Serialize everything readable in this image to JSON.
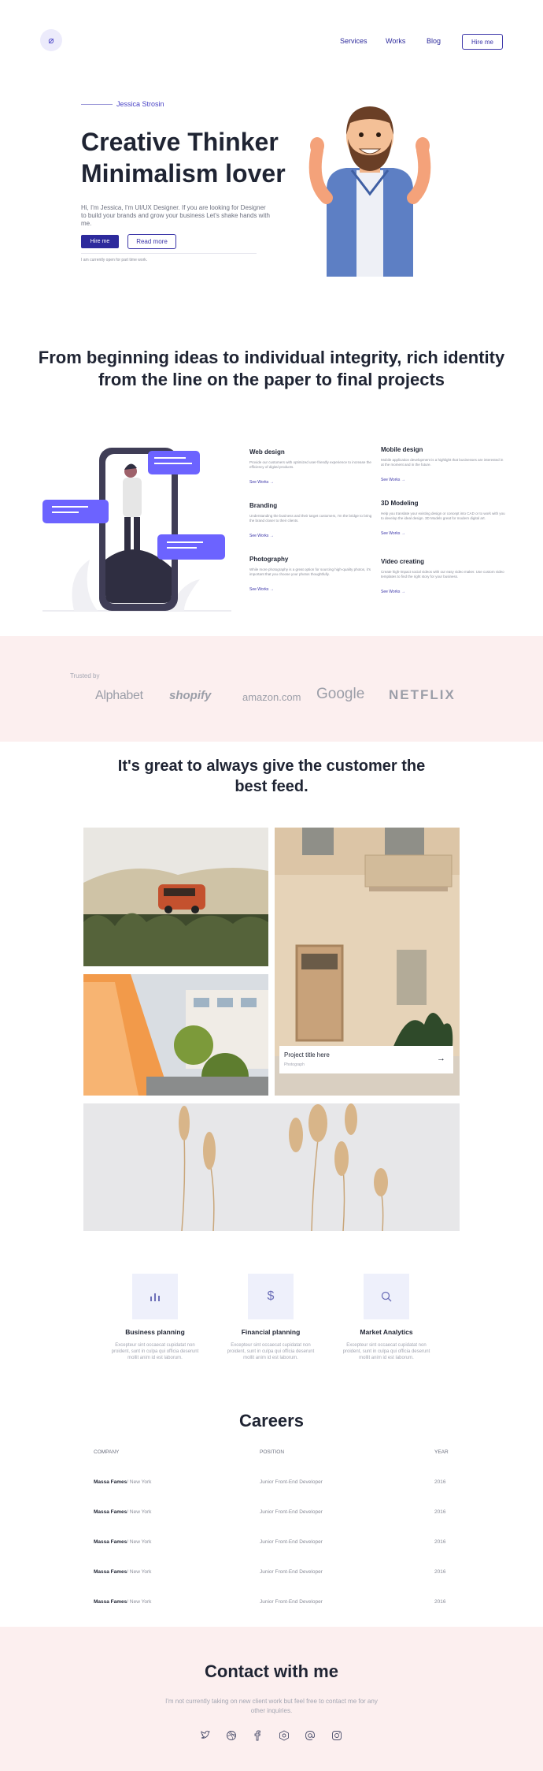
{
  "header": {
    "logo_glyph": "⌀",
    "nav": [
      "Services",
      "Works",
      "Blog"
    ],
    "hire_label": "Hire me"
  },
  "hero": {
    "eyebrow": "Jessica Strosin",
    "title_line1": "Creative Thinker",
    "title_line2": "Minimalism lover",
    "description": "Hi, I'm Jessica, I'm UI/UX Designer. If you are looking for Designer to build your brands and grow your business Let's shake hands with me.",
    "primary_button": "Hire me",
    "secondary_button": "Read more",
    "note": "I am currently open for part time work."
  },
  "tagline": "From beginning ideas to individual integrity, rich identity from the line on the paper to final projects",
  "services": [
    {
      "title": "Web design",
      "desc": "Provide our customers with optimized user-friendly experience to increase the efficiency of digital products.",
      "link": "See Works →"
    },
    {
      "title": "Mobile design",
      "desc": "Mobile application development is a highlight that businesses are interested in at the moment and in the future.",
      "link": "See Works →"
    },
    {
      "title": "Branding",
      "desc": "Understanding the business and their target customers, I'm the bridge to bring the brand closer to their clients.",
      "link": "See Works →"
    },
    {
      "title": "3D Modeling",
      "desc": "Help you translate your existing design or concept into CAD or to work with you to develop the ideal design. 3D Models great for modern digital art.",
      "link": "See Works →"
    },
    {
      "title": "Photography",
      "desc": "While more photography is a great option for sourcing high-quality photos, it's important that you choose your photos thoughtfully.",
      "link": "See Works →"
    },
    {
      "title": "Video creating",
      "desc": "Create high-impact social videos with our easy video maker. Use custom video templates to find the right story for your business.",
      "link": "See Works →"
    }
  ],
  "trusted": {
    "label": "Trusted by",
    "brands": [
      "Alphabet",
      "shopify",
      "amazon.com",
      "Google",
      "NETFLIX"
    ]
  },
  "feed": {
    "title": "It's great to always give the customer the best feed.",
    "project_title": "Project title here",
    "project_sub": "Photograph"
  },
  "features": [
    {
      "icon": "bar-chart-icon",
      "title": "Business planning",
      "desc": "Excepteur sint occaecat cupidatat non proident, sunt in culpa qui officia deserunt mollit anim id est laborum."
    },
    {
      "icon": "dollar-icon",
      "title": "Financial planning",
      "desc": "Excepteur sint occaecat cupidatat non proident, sunt in culpa qui officia deserunt mollit anim id est laborum."
    },
    {
      "icon": "search-icon",
      "title": "Market Analytics",
      "desc": "Excepteur sint occaecat cupidatat non proident, sunt in culpa qui officia deserunt mollit anim id est laborum."
    }
  ],
  "careers": {
    "title": "Careers",
    "headers": [
      "COMPANY",
      "POSITION",
      "YEAR"
    ],
    "rows": [
      {
        "company": "Massa Fames",
        "city": "/ New York",
        "position": "Junior Front-End Developer",
        "year": "2016"
      },
      {
        "company": "Massa Fames",
        "city": "/ New York",
        "position": "Junior Front-End Developer",
        "year": "2016"
      },
      {
        "company": "Massa Fames",
        "city": "/ New York",
        "position": "Junior Front-End Developer",
        "year": "2016"
      },
      {
        "company": "Massa Fames",
        "city": "/ New York",
        "position": "Junior Front-End Developer",
        "year": "2016"
      },
      {
        "company": "Massa Fames",
        "city": "/ New York",
        "position": "Junior Front-End Developer",
        "year": "2016"
      }
    ]
  },
  "contact": {
    "title": "Contact with me",
    "description": "I'm not currently taking on new client work but feel free to contact me for any other inquiries.",
    "socials": [
      "twitter-icon",
      "dribbble-icon",
      "facebook-icon",
      "behance-icon",
      "email-icon",
      "instagram-icon"
    ]
  },
  "colors": {
    "primary": "#2d2a9c",
    "accent_purple": "#6c63ff",
    "band_pink": "#fcefef",
    "text_dark": "#1f2433"
  }
}
